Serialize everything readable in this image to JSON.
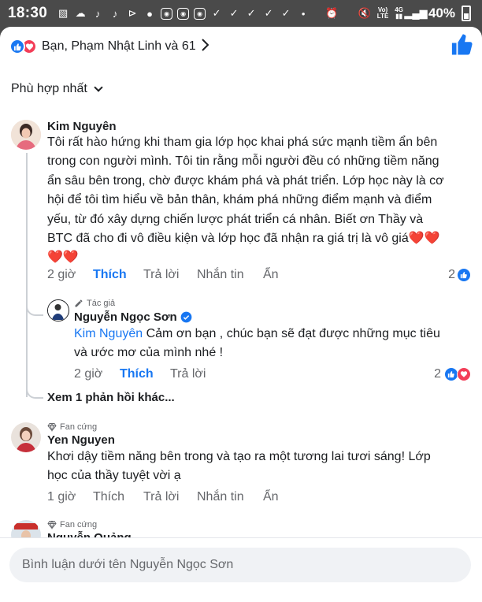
{
  "status_bar": {
    "time": "18:30",
    "network_top": "Vo)",
    "network_bottom": "LTE",
    "signal": "4G",
    "battery": "40%"
  },
  "reactions": {
    "summary": "Bạn, Phạm Nhật Linh và 61",
    "icons": [
      "like-icon",
      "love-icon"
    ]
  },
  "sort": {
    "label": "Phù hợp nhất"
  },
  "comments": [
    {
      "author": "Kim Nguyên",
      "text_lines": [
        "Tôi rất hào hứng khi tham gia lớp học khai phá sức mạnh tiềm ẩn bên",
        "trong con người mình. Tôi tin rằng mỗi người đều có những tiềm năng",
        "ẩn sâu bên trong, chờ được khám phá và phát triển. Lớp học này là cơ",
        "hội để tôi tìm hiểu về bản thân, khám phá những điểm mạnh và điểm",
        "yếu, từ đó xây dựng chiến lược phát triển cá nhân. Biết ơn Thầy và",
        "BTC đã cho đi vô điều kiện và lớp học đã nhận ra giá trị là vô giá❤️❤️",
        "❤️❤️"
      ],
      "time": "2 giờ",
      "like": "Thích",
      "reply": "Trả lời",
      "message": "Nhắn tin",
      "hide": "Ẩn",
      "reaction_count": "2",
      "replies": [
        {
          "badge": "Tác giả",
          "author": "Nguyễn Ngọc Sơn",
          "mention": "Kim Nguyên",
          "text_line1": " Cảm ơn bạn , chúc bạn sẽ đạt được những mục tiêu",
          "text_line2": "và ước mơ của mình  nhé !",
          "time": "2 giờ",
          "like": "Thích",
          "reply": "Trả lời",
          "reaction_count": "2"
        }
      ],
      "view_more": "Xem 1 phản hồi khác..."
    },
    {
      "badge": "Fan cứng",
      "author": "Yen Nguyen",
      "text_lines": [
        "Khơi dậy tiềm năng bên trong và tạo ra một tương lai tươi sáng!  Lớp",
        "học của thầy tuyệt vời ạ"
      ],
      "time": "1 giờ",
      "like": "Thích",
      "reply": "Trả lời",
      "message": "Nhắn tin",
      "hide": "Ẩn"
    },
    {
      "badge": "Fan cứng",
      "author": "Nguyễn Quảng"
    }
  ],
  "composer": {
    "placeholder": "Bình luận dưới tên Nguyễn Ngọc Sơn"
  },
  "colors": {
    "accent": "#1877f2",
    "love": "#f33e58",
    "muted": "#65676b"
  }
}
